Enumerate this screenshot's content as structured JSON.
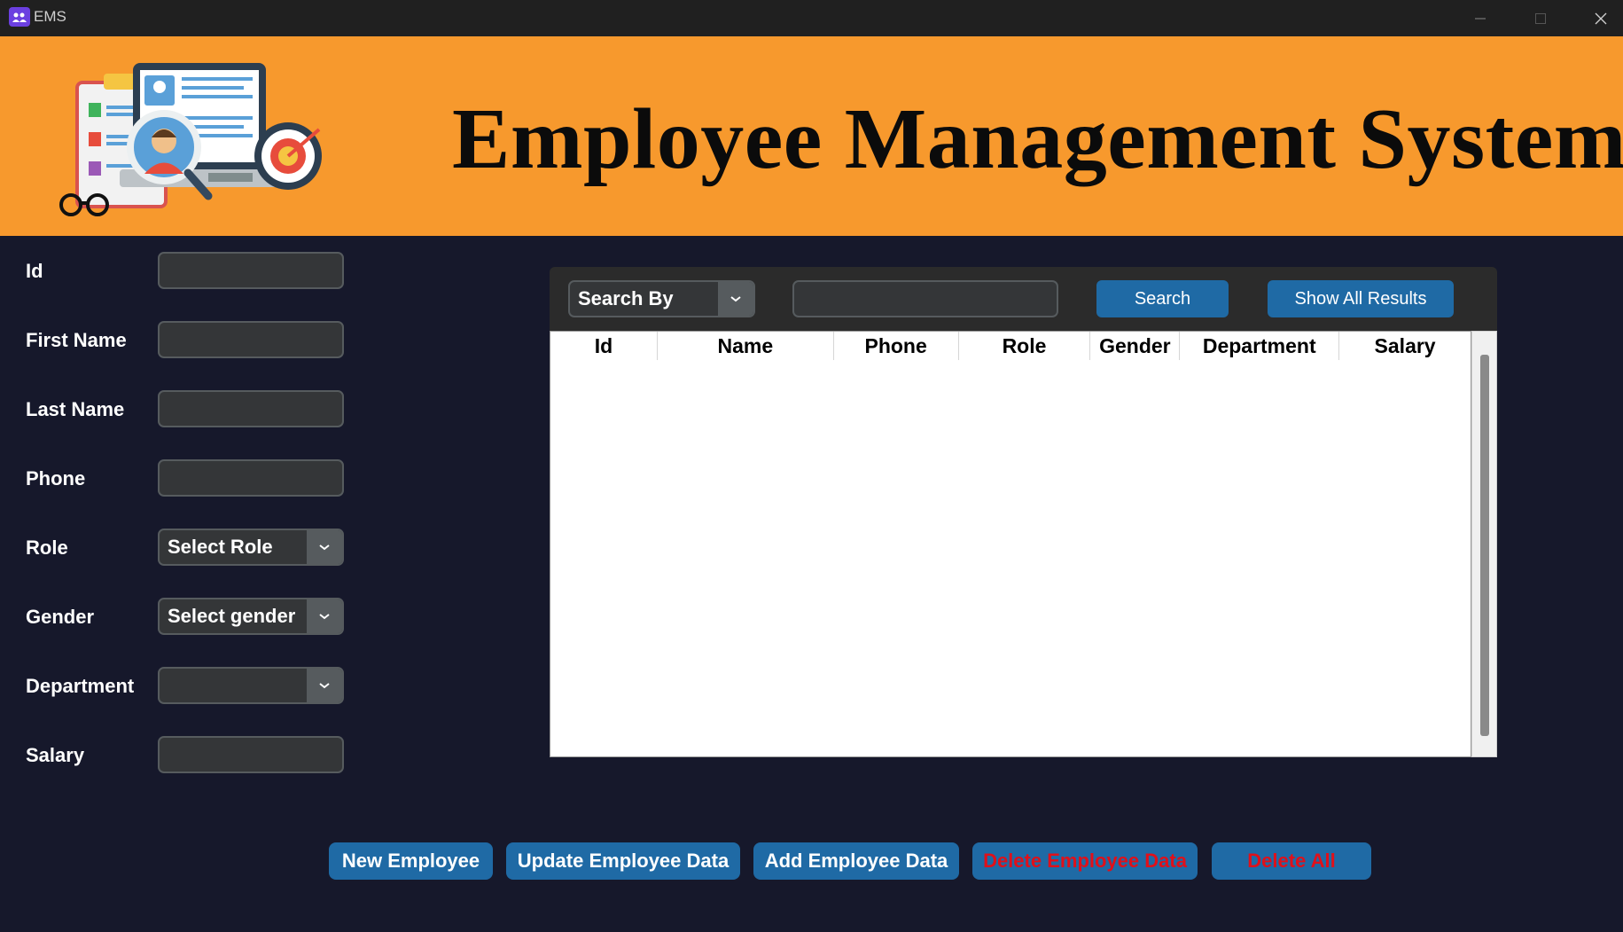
{
  "window": {
    "title": "EMS",
    "controls": [
      "minimize-icon",
      "maximize-icon",
      "close-icon"
    ]
  },
  "banner": {
    "title": "Employee Management System",
    "background": "#f7992d"
  },
  "form": {
    "fields": [
      {
        "label": "Id",
        "type": "input",
        "value": ""
      },
      {
        "label": "First Name",
        "type": "input",
        "value": ""
      },
      {
        "label": "Last Name",
        "type": "input",
        "value": ""
      },
      {
        "label": "Phone",
        "type": "input",
        "value": ""
      },
      {
        "label": "Role",
        "type": "combo",
        "value": "Select Role"
      },
      {
        "label": "Gender",
        "type": "combo",
        "value": "Select gender"
      },
      {
        "label": "Department",
        "type": "combo",
        "value": ""
      },
      {
        "label": "Salary",
        "type": "input",
        "value": ""
      }
    ]
  },
  "search": {
    "combo_value": "Search By",
    "input_value": "",
    "search_label": "Search",
    "show_all_label": "Show All Results"
  },
  "table": {
    "columns": [
      "Id",
      "Name",
      "Phone",
      "Role",
      "Gender",
      "Department",
      "Salary"
    ],
    "rows": []
  },
  "actions": {
    "new_employee": "New Employee",
    "update_employee": "Update Employee Data",
    "add_employee": "Add Employee Data",
    "delete_employee": "Delete Employee Data",
    "delete_all": "Delete All"
  },
  "colors": {
    "background": "#16182b",
    "accent": "#1f6aa5",
    "danger_text": "#e0101a",
    "banner": "#f7992d"
  }
}
